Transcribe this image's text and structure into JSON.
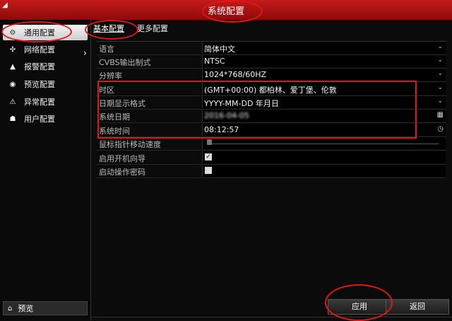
{
  "window": {
    "title": "系统配置",
    "corner_icon": "caret-icon"
  },
  "sidebar": {
    "items": [
      {
        "label": "通用配置",
        "icon": "gear-icon",
        "active": true
      },
      {
        "label": "网络配置",
        "icon": "network-icon"
      },
      {
        "label": "报警配置",
        "icon": "alarm-icon"
      },
      {
        "label": "预览配置",
        "icon": "preview-icon"
      },
      {
        "label": "异常配置",
        "icon": "warning-icon"
      },
      {
        "label": "用户配置",
        "icon": "users-icon"
      }
    ],
    "bottom": {
      "label": "预览",
      "icon": "home-icon"
    }
  },
  "tabs": [
    {
      "label": "基本配置",
      "active": true
    },
    {
      "label": "更多配置"
    }
  ],
  "settings": [
    {
      "label": "语言",
      "value": "简体中文",
      "control": "dropdown"
    },
    {
      "label": "CVBS输出制式",
      "value": "NTSC",
      "control": "dropdown"
    },
    {
      "label": "分辨率",
      "value": "1024*768/60HZ",
      "control": "dropdown"
    },
    {
      "label": "时区",
      "value": "(GMT+00:00) 都柏林、爱丁堡、伦敦",
      "control": "dropdown"
    },
    {
      "label": "日期显示格式",
      "value": "YYYY-MM-DD 年月日",
      "control": "dropdown"
    },
    {
      "label": "系统日期",
      "value": "2016-04-05",
      "control": "date",
      "icon": "calendar-icon"
    },
    {
      "label": "系统时间",
      "value": "08:12:57",
      "control": "time",
      "icon": "clock-icon"
    },
    {
      "label": "鼠标指针移动速度",
      "control": "slider",
      "level": 0.0
    },
    {
      "label": "启用开机向导",
      "control": "checkbox",
      "checked": true
    },
    {
      "label": "启动操作密码",
      "control": "checkbox",
      "checked": false
    }
  ],
  "buttons": {
    "apply": "应用",
    "back": "返回"
  },
  "colors": {
    "titlebar": "#b51212",
    "annotation": "#e21616"
  }
}
